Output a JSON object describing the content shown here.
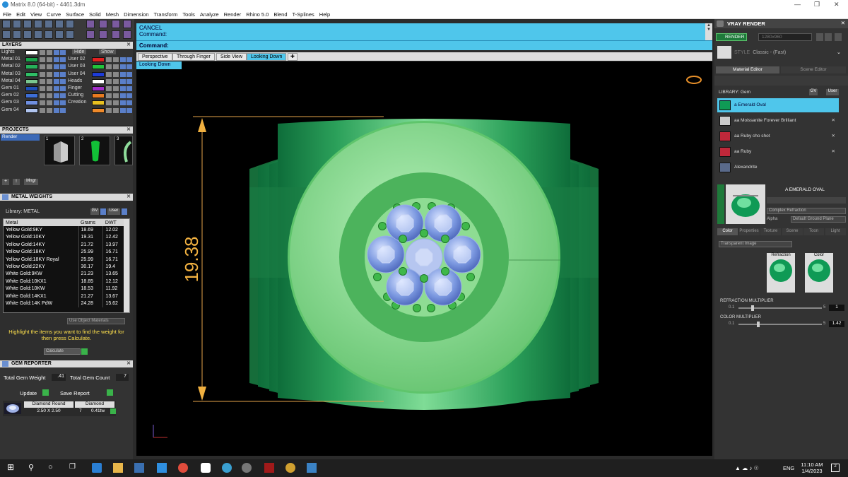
{
  "window": {
    "title": "Matrix 8.0 (64-bit) - 4461.3dm"
  },
  "menu": [
    "File",
    "Edit",
    "View",
    "Curve",
    "Surface",
    "Solid",
    "Mesh",
    "Dimension",
    "Transform",
    "Tools",
    "Analyze",
    "Render",
    "Rhino 5.0",
    "Blend",
    "T-Splines",
    "Help"
  ],
  "layers": {
    "title": "LAYERS",
    "hide_label": "Hide",
    "show_label": "Show",
    "left": [
      {
        "name": "Lights",
        "color": "#ffffff"
      },
      {
        "name": "Metal 01",
        "color": "#1aa34a"
      },
      {
        "name": "Metal 02",
        "color": "#26b05a"
      },
      {
        "name": "Metal 03",
        "color": "#2fbf66"
      },
      {
        "name": "Metal 04",
        "color": "#7ac68f"
      },
      {
        "name": "Gem 01",
        "color": "#1f4fb8"
      },
      {
        "name": "Gem 02",
        "color": "#3d6ed6"
      },
      {
        "name": "Gem 03",
        "color": "#6f8fe0"
      },
      {
        "name": "Gem 04",
        "color": "#b0c4ee"
      }
    ],
    "right": [
      {
        "name": "User 01",
        "color": "#e22020"
      },
      {
        "name": "User 02",
        "color": "#21c43b"
      },
      {
        "name": "User 03",
        "color": "#1d3cd9"
      },
      {
        "name": "User 04",
        "color": "#ffffff"
      },
      {
        "name": "Heads",
        "color": "#a12ec9"
      },
      {
        "name": "Finger",
        "color": "#e87a20"
      },
      {
        "name": "Cutting",
        "color": "#e8c020"
      },
      {
        "name": "Creation",
        "color": "#f08a2a"
      }
    ]
  },
  "projects": {
    "title": "PROJECTS",
    "item": "Render",
    "thumbs": [
      "1",
      "2",
      "3"
    ],
    "mngr": "Mngr"
  },
  "metal_weights": {
    "title": "METAL WEIGHTS",
    "library_label": "Library: METAL",
    "gv": "GV",
    "user": "User",
    "columns": [
      "Metal",
      "Grams",
      "DWT"
    ],
    "rows": [
      [
        "Yellow Gold:9KY",
        "18.69",
        "12.02"
      ],
      [
        "Yellow Gold:10KY",
        "19.31",
        "12.42"
      ],
      [
        "Yellow Gold:14KY",
        "21.72",
        "13.97"
      ],
      [
        "Yellow Gold:18KY",
        "25.99",
        "16.71"
      ],
      [
        "Yellow Gold:18KY Royal",
        "25.99",
        "16.71"
      ],
      [
        "Yellow Gold:22KY",
        "30.17",
        "19.4"
      ],
      [
        "White Gold:9KW",
        "21.23",
        "13.65"
      ],
      [
        "White Gold:10KX1",
        "18.85",
        "12.12"
      ],
      [
        "White Gold:10KW",
        "18.53",
        "11.92"
      ],
      [
        "White Gold:14KX1",
        "21.27",
        "13.67"
      ],
      [
        "White Gold:14K PdW",
        "24.28",
        "15.62"
      ]
    ],
    "use_object_materials": "Use Object Materials",
    "hint": "Highlight the items you want to find the weight for then press Calculate.",
    "calculate": "Calculate"
  },
  "gem_reporter": {
    "title": "GEM REPORTER",
    "total_weight_label": "Total Gem Weight",
    "total_weight_value": ".41",
    "total_count_label": "Total Gem Count",
    "total_count_value": "7",
    "update": "Update",
    "save_report": "Save Report",
    "item": {
      "shape": "Diamond Round",
      "size": "2.50 X 2.50",
      "type": "Diamond",
      "count": "7",
      "weight": "0.41tw"
    }
  },
  "command": {
    "line1": "CANCEL",
    "line2": "Command:",
    "prompt": "Command:"
  },
  "view_tabs": [
    "Perspective",
    "Through Finger",
    "Side View",
    "Looking Down"
  ],
  "active_view": "Looking Down",
  "viewport": {
    "label": "Looking Down",
    "dimension": "19.38"
  },
  "vray": {
    "title": "VRAY RENDER",
    "render": "RENDER",
    "resolution": "1280x960",
    "style_label": "STYLE",
    "style_value": "Classic - (Fast)",
    "tabs": [
      "Material Editor",
      "Scene Editor"
    ],
    "library_label": "LIBRARY: Gem",
    "gv": "GV",
    "user": "User",
    "materials": [
      {
        "name": "a Emerald Oval",
        "color": "#0f9a55",
        "selected": true
      },
      {
        "name": "aa Moissanite Forever Brilliant",
        "color": "#cccccc",
        "selected": false
      },
      {
        "name": "aa Ruby cho shot",
        "color": "#c0283a",
        "selected": false
      },
      {
        "name": "aa Ruby",
        "color": "#c0283a",
        "selected": false
      },
      {
        "name": "Alexandrite",
        "color": "#5a6a8a",
        "selected": false
      }
    ],
    "preview_name": "A EMERALD OVAL",
    "complex_refraction": "Complex Refraction",
    "alpha": "Alpha",
    "ground_plane": "Default Ground Plane",
    "sub_tabs": [
      "Color",
      "Properties",
      "Texture",
      "Scene",
      "Toon",
      "Light"
    ],
    "transparent_image": "Transparent Image",
    "swatch_refraction": "Refraction",
    "swatch_color": "Color",
    "refraction_multiplier": {
      "label": "REFRACTION MULTIPLIER",
      "min": "0.1",
      "max": "5",
      "value": "1"
    },
    "color_multiplier": {
      "label": "COLOR MULTIPLIER",
      "min": "0.1",
      "max": "5",
      "value": "1.42"
    }
  },
  "taskbar": {
    "lang": "ENG",
    "time": "11:10 AM",
    "date": "1/4/2023",
    "notif": "2"
  }
}
